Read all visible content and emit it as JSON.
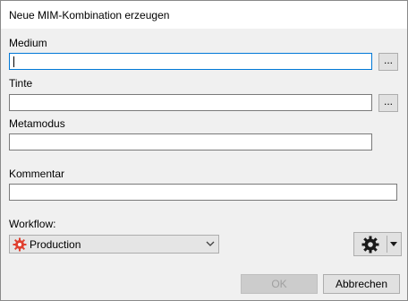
{
  "dialog": {
    "title": "Neue MIM-Kombination erzeugen"
  },
  "fields": {
    "medium": {
      "label": "Medium",
      "value": ""
    },
    "tinte": {
      "label": "Tinte",
      "value": ""
    },
    "metamodus": {
      "label": "Metamodus",
      "value": ""
    },
    "kommentar": {
      "label": "Kommentar",
      "value": ""
    }
  },
  "browse_label": "...",
  "workflow": {
    "label": "Workflow:",
    "selected": "Production",
    "icon": "gear-icon",
    "icon_color": "#e04030"
  },
  "buttons": {
    "ok": "OK",
    "cancel": "Abbrechen"
  }
}
